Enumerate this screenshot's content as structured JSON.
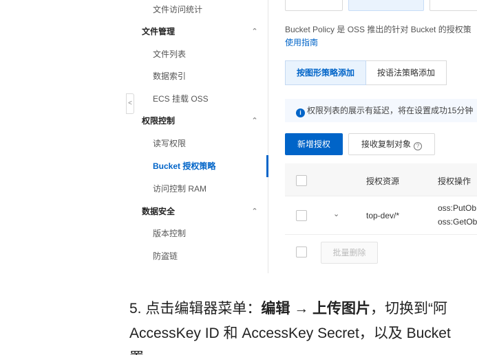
{
  "sidebar": {
    "items": [
      {
        "label": "文件访问统计",
        "type": "sub"
      },
      {
        "label": "文件管理",
        "type": "group",
        "chevron": "^"
      },
      {
        "label": "文件列表",
        "type": "sub"
      },
      {
        "label": "数据索引",
        "type": "sub"
      },
      {
        "label": "ECS 挂载 OSS",
        "type": "sub"
      },
      {
        "label": "权限控制",
        "type": "group",
        "chevron": "^"
      },
      {
        "label": "读写权限",
        "type": "sub"
      },
      {
        "label": "Bucket 授权策略",
        "type": "sub",
        "active": true
      },
      {
        "label": "访问控制 RAM",
        "type": "sub"
      },
      {
        "label": "数据安全",
        "type": "group",
        "chevron": "^"
      },
      {
        "label": "版本控制",
        "type": "sub"
      },
      {
        "label": "防盗链",
        "type": "sub"
      }
    ],
    "collapse_icon": "<"
  },
  "main": {
    "description": "Bucket Policy 是 OSS 推出的针对 Bucket 的授权策",
    "guide_link": "使用指南",
    "tabs": [
      {
        "label": "按图形策略添加",
        "active": true
      },
      {
        "label": "按语法策略添加",
        "active": false
      }
    ],
    "notice": "权限列表的展示有延迟，将在设置成功15分钟",
    "add_button": "新增授权",
    "receive_button": "接收复制对象",
    "table": {
      "headers": [
        "授权资源",
        "授权操作"
      ],
      "rows": [
        {
          "resource": "top-dev/*",
          "actions": [
            "oss:PutOb",
            "oss:GetOb"
          ]
        }
      ],
      "batch_delete": "批量删除"
    }
  },
  "article": {
    "line1_prefix": "5. 点击编辑器菜单：",
    "line1_bold1": "编辑",
    "line1_arrow": " → ",
    "line1_bold2": "上传图片",
    "line1_suffix": "，切换到“阿",
    "line2": "AccessKey ID 和 AccessKey Secret，以及 Bucket",
    "line3": "置"
  }
}
